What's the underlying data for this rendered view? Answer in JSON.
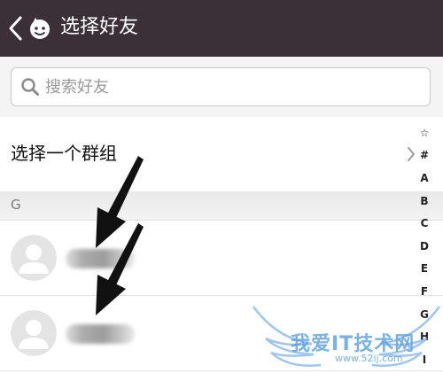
{
  "header": {
    "title": "选择好友",
    "background": "#3b3038"
  },
  "search": {
    "placeholder": "搜索好友",
    "value": ""
  },
  "group": {
    "label": "选择一个群组"
  },
  "section": {
    "letter": "G"
  },
  "contacts": [
    {
      "name_hidden": true
    },
    {
      "name_hidden": true
    }
  ],
  "index_bar": {
    "letters": [
      "☆",
      "#",
      "A",
      "B",
      "C",
      "D",
      "E",
      "F",
      "G",
      "H",
      "I"
    ]
  },
  "watermark": {
    "text": "我爱IT技术网",
    "url": "www.52ij.com"
  }
}
